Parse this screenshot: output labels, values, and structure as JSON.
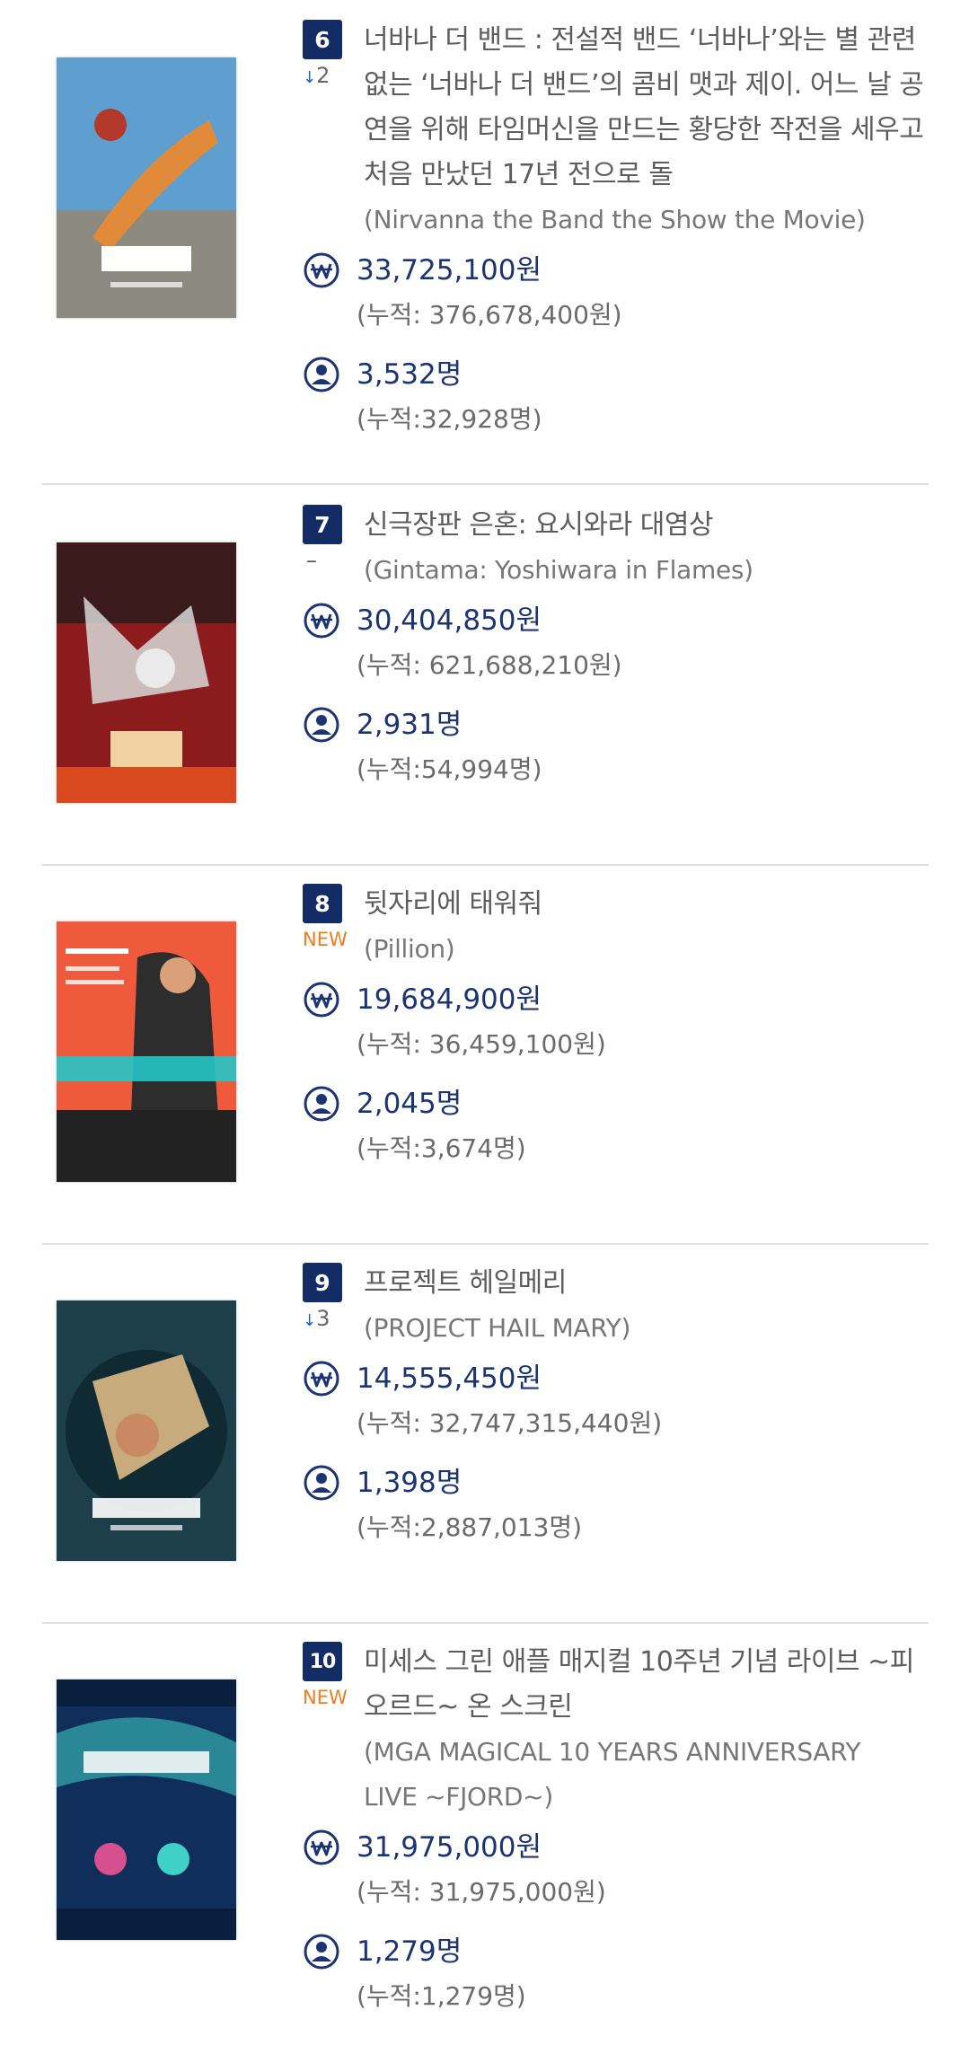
{
  "currency_unit": "원",
  "people_unit": "명",
  "cumulative_prefix": "(누적: ",
  "cumulative_prefix_people": "(누적:",
  "cumulative_suffix": ")",
  "entries": [
    {
      "rank": "6",
      "change": {
        "type": "down",
        "arrow": "↓",
        "value": "2"
      },
      "title_lines": [
        "너바나 더 밴드 : 전설적 밴드 ‘너바나’와는 별 관련",
        "없는 ‘너바나 더 밴드’의 콤비 맷과 제이. 어느 날 공",
        "연을 위해 타임머신을 만드는 황당한 작전을 세우고",
        "처음 만났던 17년 전으로 돌"
      ],
      "original_lines": [
        "(Nirvanna the Band the Show the Movie)"
      ],
      "sales": "33,725,100원",
      "sales_cumulative": "(누적: 376,678,400원)",
      "audience": "3,532명",
      "audience_cumulative": "(누적:32,928명)",
      "poster_colors": {
        "bg": "#5f9fcf",
        "accent": "#e08a3a"
      }
    },
    {
      "rank": "7",
      "change": {
        "type": "same",
        "value": "–"
      },
      "title_lines": [
        "신극장판 은혼: 요시와라 대염상"
      ],
      "original_lines": [
        "(Gintama: Yoshiwara in Flames)"
      ],
      "sales": "30,404,850원",
      "sales_cumulative": "(누적: 621,688,210원)",
      "audience": "2,931명",
      "audience_cumulative": "(누적:54,994명)",
      "poster_colors": {
        "bg": "#8c1b1e",
        "accent": "#d8d8d8"
      }
    },
    {
      "rank": "8",
      "change": {
        "type": "new",
        "value": "NEW"
      },
      "title_lines": [
        "뒷자리에 태워줘"
      ],
      "original_lines": [
        "(Pillion)"
      ],
      "sales": "19,684,900원",
      "sales_cumulative": "(누적: 36,459,100원)",
      "audience": "2,045명",
      "audience_cumulative": "(누적:3,674명)",
      "poster_colors": {
        "bg": "#f05a3c",
        "accent": "#2d2d2d"
      }
    },
    {
      "rank": "9",
      "change": {
        "type": "down",
        "arrow": "↓",
        "value": "3"
      },
      "title_lines": [
        "프로젝트 헤일메리"
      ],
      "original_lines": [
        "(PROJECT HAIL MARY)"
      ],
      "sales": "14,555,450원",
      "sales_cumulative": "(누적: 32,747,315,440원)",
      "audience": "1,398명",
      "audience_cumulative": "(누적:2,887,013명)",
      "poster_colors": {
        "bg": "#1d3f4a",
        "accent": "#e8c28a"
      }
    },
    {
      "rank": "10",
      "change": {
        "type": "new",
        "value": "NEW"
      },
      "title_lines": [
        "미세스 그린 애플 매지컬 10주년 기념 라이브 ~피",
        "오르드~ 온 스크린"
      ],
      "original_lines": [
        "(MGA MAGICAL 10 YEARS ANNIVERSARY",
        "LIVE ~FJORD~)"
      ],
      "sales": "31,975,000원",
      "sales_cumulative": "(누적: 31,975,000원)",
      "audience": "1,279명",
      "audience_cumulative": "(누적:1,279명)",
      "poster_colors": {
        "bg": "#0f2f5a",
        "accent": "#3fd0c8"
      }
    }
  ],
  "icons": {
    "sales": "won-circle-icon",
    "audience": "person-circle-icon"
  },
  "theme": {
    "navy": "#142c66",
    "text_blue": "#1c3472",
    "new_orange": "#ef7c1f",
    "down_blue": "#1d5fbf"
  }
}
